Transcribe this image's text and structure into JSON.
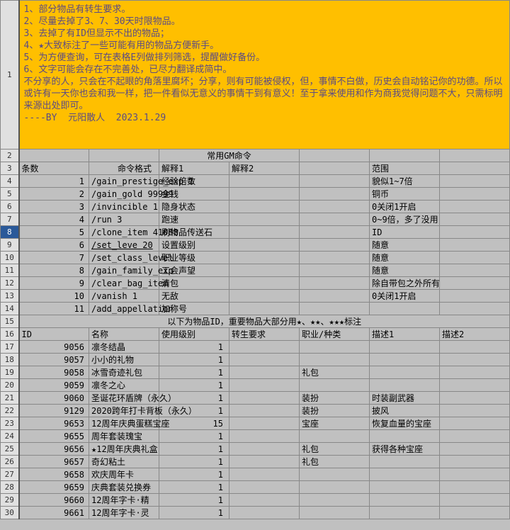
{
  "note": "1、部分物品有转生要求。\n2、尽量去掉了3、7、30天时限物品。\n3、去掉了有ID但显示不出的物品；\n4、★大致标注了一些可能有用的物品方便新手。\n5、为方便查询，可在表格E列做排列筛选，提醒做好备份。\n6、文字可能会存在不完善处，已尽力翻译成简中。\n不分享的人，只会在不起眼的角落里腐坏；分享，则有可能被侵权，但，事情不白做，历史会自动铭记你的功德。所以或许有一天你也会和我一样，把一件看似无意义的事情干到有意义！至于拿来使用和作为商我觉得问题不大，只需标明来源出处即可。\n----BY  元阳散人  2023.1.29",
  "gmTitle": "常用GM命令",
  "headers1": {
    "a": "条数",
    "b": "命令格式",
    "c": "解释1",
    "d": "解释2",
    "f": "范围"
  },
  "cmd": [
    {
      "n": "1",
      "f": "/gain_prestige_exp 1",
      "i1": "经验倍数",
      "i2": "",
      "r": "貌似1~7倍"
    },
    {
      "n": "2",
      "f": "/gain_gold 99999",
      "i1": "金钱",
      "i2": "",
      "r": "铜币"
    },
    {
      "n": "3",
      "f": "/invincible 1",
      "i1": "隐身状态",
      "i2": "",
      "r": "0关闭1开启"
    },
    {
      "n": "4",
      "f": "/run 3",
      "i1": "跑速",
      "i2": "",
      "r": "0~9倍，多了没用"
    },
    {
      "n": "5",
      "f": "/clone_item 41088",
      "i1": "刷物品传送石",
      "i2": "",
      "r": "ID"
    },
    {
      "n": "6",
      "f": "/set_leve 20",
      "i1": "设置级别",
      "i2": "",
      "r": "随意"
    },
    {
      "n": "7",
      "f": "/set_class_level",
      "i1": "职业等级",
      "i2": "",
      "r": "随意"
    },
    {
      "n": "8",
      "f": "/gain_family_exp",
      "i1": "工会声望",
      "i2": "",
      "r": "随意"
    },
    {
      "n": "9",
      "f": "/clear_bag_item",
      "i1": "清包",
      "i2": "",
      "r": "除自带包之外所有"
    },
    {
      "n": "10",
      "f": "/vanish 1",
      "i1": "无敌",
      "i2": "",
      "r": "0关闭1开启"
    },
    {
      "n": "11",
      "f": "/add_appellation",
      "i1": "加称号",
      "i2": "",
      "r": ""
    }
  ],
  "itemsTitle": "以下为物品ID，重要物品大部分用★、★★、★★★标注",
  "headers2": {
    "a": "ID",
    "b": "名称",
    "c": "使用级别",
    "d": "转生要求",
    "e": "职业/种类",
    "f": "描述1",
    "g": "描述2"
  },
  "items": [
    {
      "id": "9056",
      "name": "凛冬结晶",
      "lvl": "1",
      "rb": "",
      "cls": "",
      "d1": "",
      "d2": ""
    },
    {
      "id": "9057",
      "name": "小小的礼物",
      "lvl": "1",
      "rb": "",
      "cls": "",
      "d1": "",
      "d2": ""
    },
    {
      "id": "9058",
      "name": "冰雪奇迹礼包",
      "lvl": "1",
      "rb": "",
      "cls": "礼包",
      "d1": "",
      "d2": ""
    },
    {
      "id": "9059",
      "name": "凛冬之心",
      "lvl": "1",
      "rb": "",
      "cls": "",
      "d1": "",
      "d2": ""
    },
    {
      "id": "9060",
      "name": "圣诞花环盾牌（永久）",
      "lvl": "1",
      "rb": "",
      "cls": "装扮",
      "d1": "时装副武器",
      "d2": ""
    },
    {
      "id": "9129",
      "name": "2020跨年打卡背板（永久）",
      "lvl": "1",
      "rb": "",
      "cls": "装扮",
      "d1": "披风",
      "d2": ""
    },
    {
      "id": "9653",
      "name": "12周年庆典蛋糕宝座",
      "lvl": "15",
      "rb": "",
      "cls": "宝座",
      "d1": "恢复血量的宝座",
      "d2": ""
    },
    {
      "id": "9655",
      "name": "周年套装瑰宝",
      "lvl": "1",
      "rb": "",
      "cls": "",
      "d1": "",
      "d2": ""
    },
    {
      "id": "9656",
      "name": "★12周年庆典礼盒",
      "lvl": "1",
      "rb": "",
      "cls": "礼包",
      "d1": "获得各种宝座",
      "d2": ""
    },
    {
      "id": "9657",
      "name": "奇幻粘土",
      "lvl": "1",
      "rb": "",
      "cls": "礼包",
      "d1": "",
      "d2": ""
    },
    {
      "id": "9658",
      "name": "欢庆周年卡",
      "lvl": "1",
      "rb": "",
      "cls": "",
      "d1": "",
      "d2": ""
    },
    {
      "id": "9659",
      "name": "庆典套装兑换券",
      "lvl": "1",
      "rb": "",
      "cls": "",
      "d1": "",
      "d2": ""
    },
    {
      "id": "9660",
      "name": "12周年字卡·精",
      "lvl": "1",
      "rb": "",
      "cls": "",
      "d1": "",
      "d2": ""
    },
    {
      "id": "9661",
      "name": "12周年字卡·灵",
      "lvl": "1",
      "rb": "",
      "cls": "",
      "d1": "",
      "d2": ""
    }
  ]
}
